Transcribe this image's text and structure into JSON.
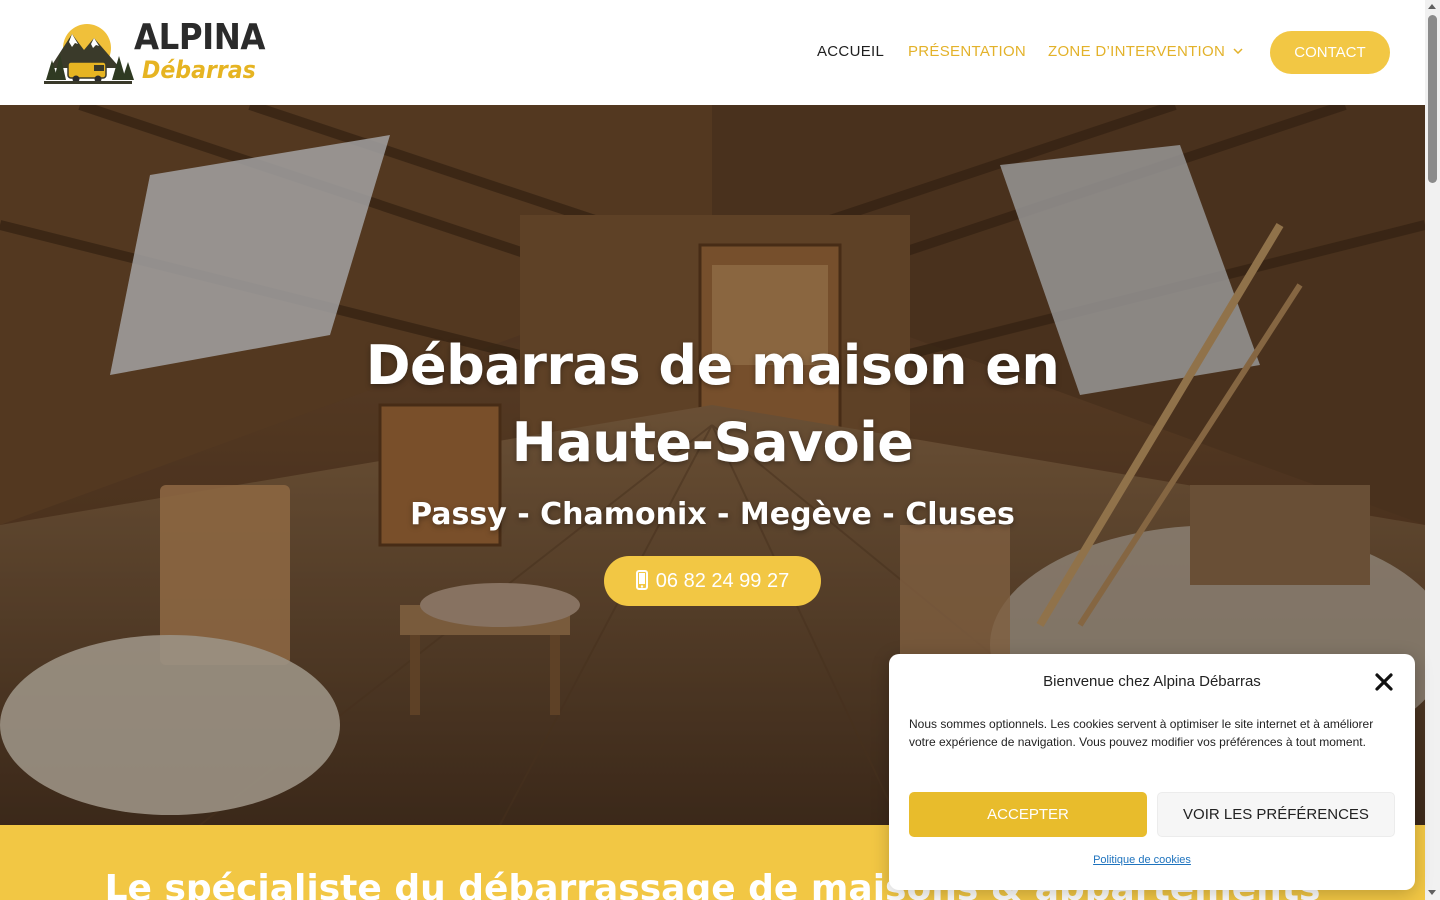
{
  "logo": {
    "word1": "ALPINA",
    "word2": "Débarras",
    "colors": {
      "dark": "#2b2b2b",
      "gold": "#e6b422"
    }
  },
  "nav": {
    "items": [
      {
        "label": "ACCUEIL",
        "active": true
      },
      {
        "label": "PRÉSENTATION",
        "active": false
      },
      {
        "label": "ZONE D’INTERVENTION",
        "active": false,
        "has_dropdown": true
      }
    ],
    "contact_label": "CONTACT"
  },
  "hero": {
    "title_line1": "Débarras de maison en",
    "title_line2": "Haute-Savoie",
    "subtitle": "Passy - Chamonix - Megève - Cluses",
    "phone_label": "06 82 24 99 27",
    "phone_icon": "mobile-phone-icon"
  },
  "band": {
    "title": "Le spécialiste du débarrassage de maisons & appartements"
  },
  "cookie": {
    "title": "Bienvenue chez Alpina Débarras",
    "text": "Nous sommes optionnels. Les cookies servent à optimiser le site internet et à améliorer votre expérience de navigation. Vous pouvez modifier vos préférences à tout moment.",
    "accept_label": "ACCEPTER",
    "prefs_label": "VOIR LES PRÉFÉRENCES",
    "policy_link": "Politique de cookies",
    "close_icon": "close-icon"
  },
  "colors": {
    "accent": "#f2c744",
    "accent_dark": "#e8bc2c",
    "nav_gold": "#e3b22a",
    "link": "#1e73be"
  }
}
